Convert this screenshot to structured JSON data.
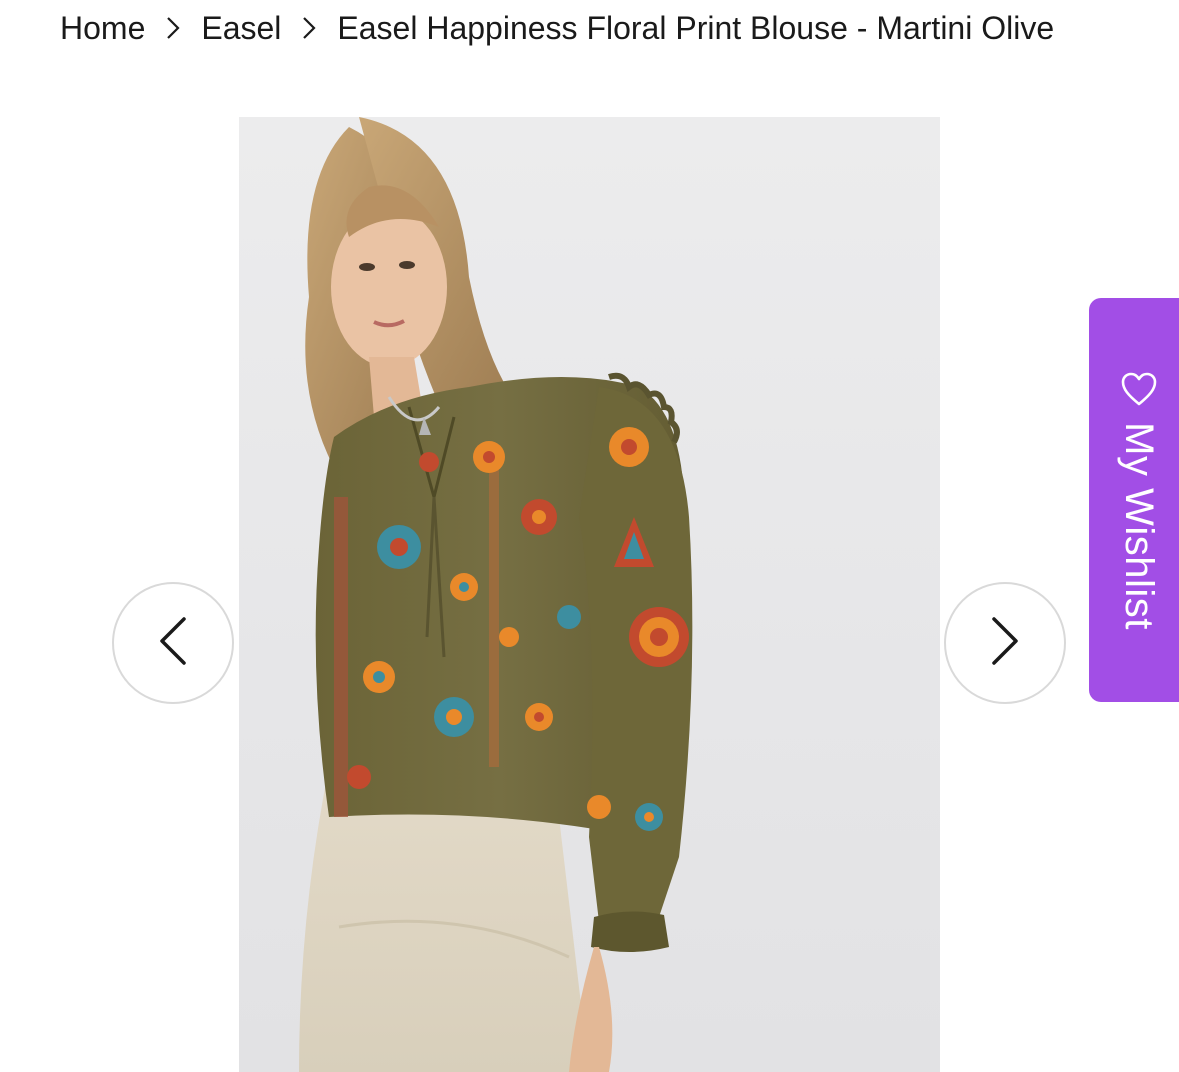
{
  "breadcrumb": {
    "items": [
      {
        "label": "Home"
      },
      {
        "label": "Easel"
      },
      {
        "label": "Easel Happiness Floral Print Blouse - Martini Olive"
      }
    ],
    "separator_icon": "chevron-right-icon"
  },
  "gallery": {
    "prev_icon": "chevron-left-icon",
    "next_icon": "chevron-right-icon"
  },
  "wishlist": {
    "label": "My Wishlist",
    "icon": "heart-outline-icon",
    "color": "#a24ee6"
  },
  "colors": {
    "text": "#1a1a1a",
    "blouse_olive": "#6f6a3c",
    "accent_orange": "#e9892a",
    "accent_red": "#c24a2e",
    "accent_teal": "#3d8ea0"
  }
}
